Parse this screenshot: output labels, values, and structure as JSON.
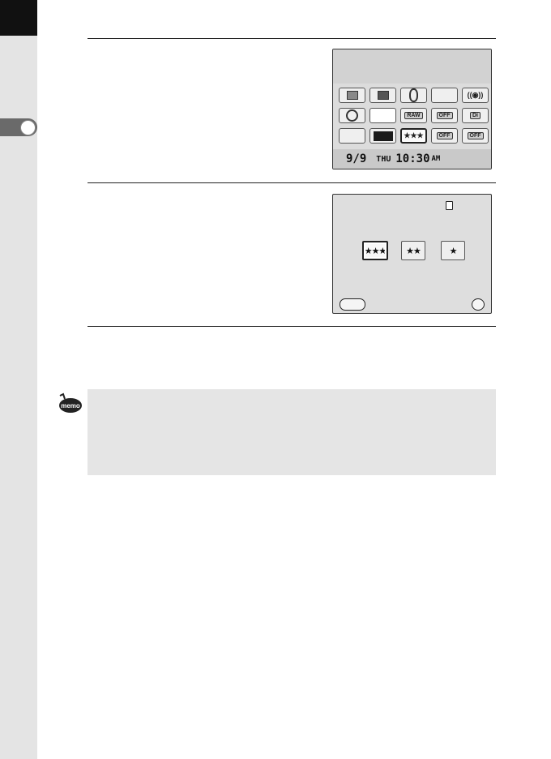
{
  "screen1": {
    "date": "9/9",
    "day": "THU",
    "time": "10:30",
    "ampm": "AM",
    "cells": [
      {
        "icon": "custom-image-icon",
        "glyph": ""
      },
      {
        "icon": "frame-icon",
        "glyph": ""
      },
      {
        "icon": "lens-icon",
        "glyph": ""
      },
      {
        "icon": "blank",
        "glyph": ""
      },
      {
        "icon": "shake-reduction-icon",
        "glyph": "((◉))"
      },
      {
        "icon": "metering-icon",
        "glyph": ""
      },
      {
        "icon": "blank",
        "glyph": ""
      },
      {
        "icon": "format-icon",
        "glyph": ""
      },
      {
        "icon": "off-icon",
        "glyph": "OFF"
      },
      {
        "icon": "digital-filter-icon",
        "glyph": ""
      },
      {
        "icon": "blank",
        "glyph": ""
      },
      {
        "icon": "color-swatch",
        "glyph": ""
      },
      {
        "icon": "quality-icon",
        "glyph": "★★★"
      },
      {
        "icon": "off-icon",
        "glyph": "OFF"
      },
      {
        "icon": "off-icon",
        "glyph": "OFF"
      }
    ]
  },
  "screen2": {
    "options": [
      "★★★",
      "★★",
      "★"
    ],
    "selected": 0
  },
  "memo": {
    "icon_label": "memo"
  }
}
